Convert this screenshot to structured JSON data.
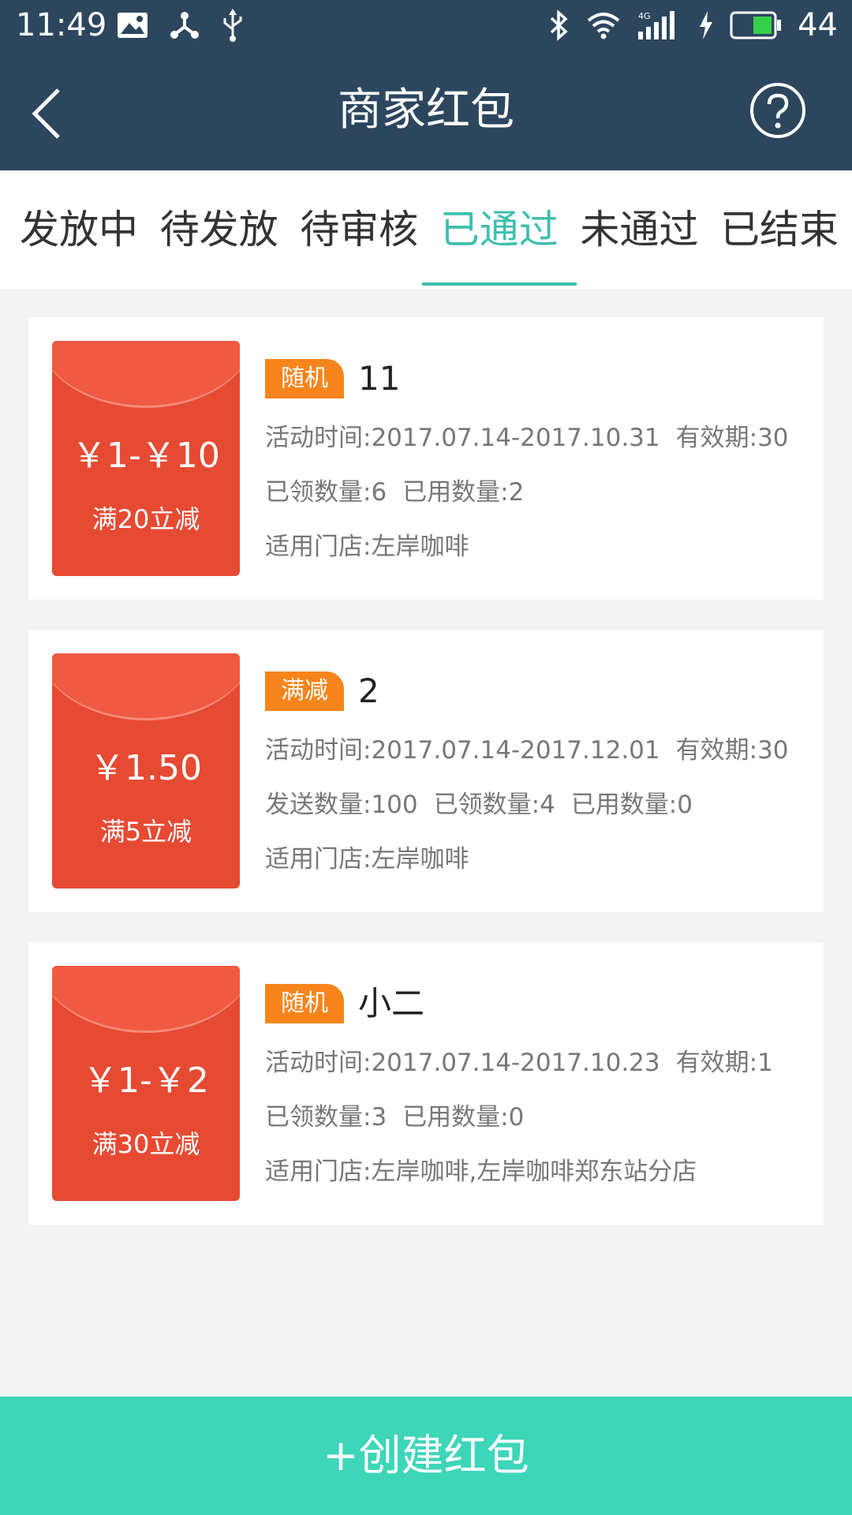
{
  "status_bar": {
    "time": "11:49",
    "battery": "44"
  },
  "header": {
    "title": "商家红包"
  },
  "tabs": [
    {
      "label": "发放中"
    },
    {
      "label": "待发放"
    },
    {
      "label": "待审核"
    },
    {
      "label": "已通过",
      "active": true
    },
    {
      "label": "未通过"
    },
    {
      "label": "已结束"
    }
  ],
  "cards": [
    {
      "amount": "￥1-￥10",
      "condition": "满20立减",
      "tag": "随机",
      "name": "11",
      "time": "活动时间:2017.07.14-2017.10.31",
      "validity": "有效期:30",
      "stat1": "已领数量:6",
      "stat2": "已用数量:2",
      "stores": "适用门店:左岸咖啡"
    },
    {
      "amount": "￥1.50",
      "condition": "满5立减",
      "tag": "满减",
      "name": "2",
      "time": "活动时间:2017.07.14-2017.12.01",
      "validity": "有效期:30",
      "stat0": "发送数量:100",
      "stat1": "已领数量:4",
      "stat2": "已用数量:0",
      "stores": "适用门店:左岸咖啡"
    },
    {
      "amount": "￥1-￥2",
      "condition": "满30立减",
      "tag": "随机",
      "name": "小二",
      "time": "活动时间:2017.07.14-2017.10.23",
      "validity": "有效期:1",
      "stat1": "已领数量:3",
      "stat2": "已用数量:0",
      "stores": "适用门店:左岸咖啡,左岸咖啡郑东站分店"
    }
  ],
  "footer": {
    "create_label": "+创建红包"
  },
  "colors": {
    "header_bg": "#2c465e",
    "accent": "#3ebfac",
    "button_bg": "#3dd6b9",
    "envelope": "#e64a33",
    "tag": "#f7851c"
  },
  "icons": [
    "image-icon",
    "share-hub-icon",
    "usb-icon",
    "bluetooth-icon",
    "wifi-icon",
    "signal-icon",
    "charging-icon",
    "battery-icon",
    "back-arrow-icon",
    "help-icon"
  ]
}
